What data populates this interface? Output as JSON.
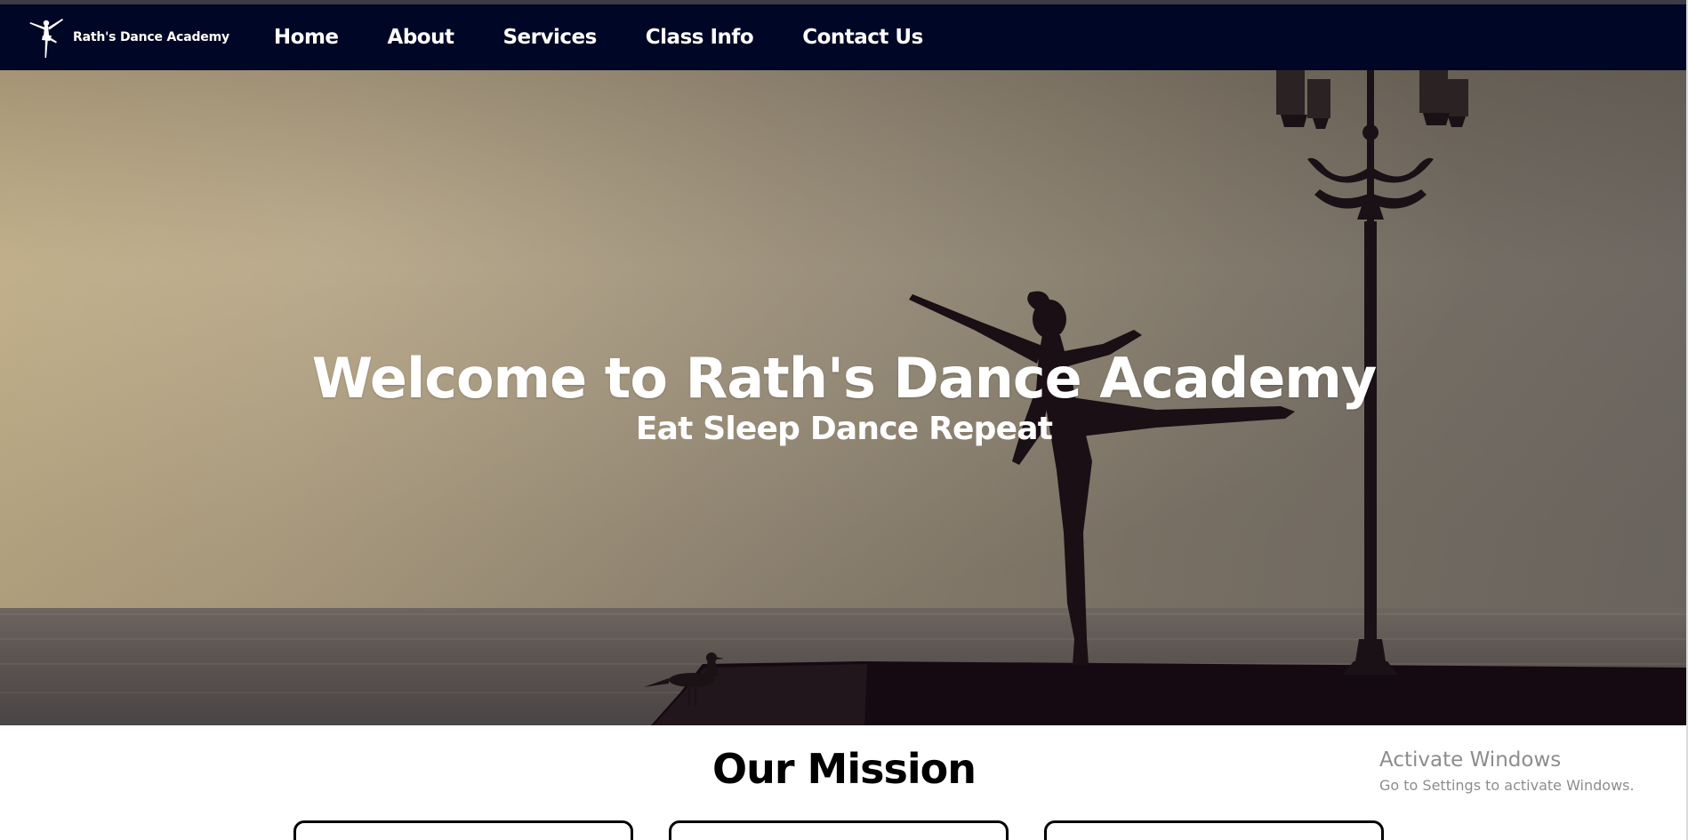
{
  "site": {
    "brand_name": "Rath's Dance Academy",
    "logo_icon": "ballerina-logo-icon"
  },
  "nav": {
    "items": [
      {
        "label": "Home"
      },
      {
        "label": "About"
      },
      {
        "label": "Services"
      },
      {
        "label": "Class Info"
      },
      {
        "label": "Contact Us"
      }
    ]
  },
  "hero": {
    "title": "Welcome to Rath's Dance Academy",
    "subtitle": "Eat Sleep Dance Repeat",
    "image": "ballerina-silhouette-seaside-lamppost"
  },
  "mission": {
    "title": "Our Mission",
    "cards": [
      {},
      {},
      {}
    ]
  },
  "overlay": {
    "watermark_title": "Activate Windows",
    "watermark_sub": "Go to Settings to activate Windows."
  },
  "colors": {
    "navbar_bg": "#000625",
    "nav_text": "#ffffff",
    "hero_text": "#ffffff",
    "heading_text": "#000000"
  }
}
